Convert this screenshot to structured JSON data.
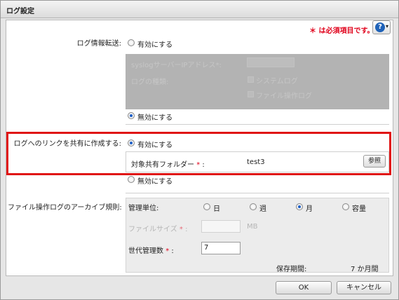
{
  "window": {
    "title": "ログ設定"
  },
  "required_note": "＊ は必須項目です。",
  "help": {
    "icon": "help-icon",
    "glyph": "?",
    "caret": "▾"
  },
  "log_transfer": {
    "label": "ログ情報転送:",
    "enable": "有効にする",
    "disable": "無効にする",
    "selected": "disable",
    "syslog_address_label": "syslogサーバーIPアドレス",
    "required_mark": "*",
    "colon": ":",
    "log_type_label": "ログの種類:",
    "system_log": "システムログ",
    "file_op_log": "ファイル操作ログ"
  },
  "shared_link": {
    "label": "ログへのリンクを共有に作成する:",
    "enable": "有効にする",
    "disable": "無効にする",
    "selected": "enable",
    "folder_label": "対象共有フォルダー",
    "required_mark": "*",
    "colon": ":",
    "folder_value": "test3",
    "browse_button": "参照"
  },
  "archive": {
    "label": "ファイル操作ログのアーカイブ規則:",
    "unit_label": "管理単位:",
    "options": [
      "日",
      "週",
      "月",
      "容量"
    ],
    "selected": "月",
    "file_size_label": "ファイルサイズ",
    "required_mark": "*",
    "colon": ":",
    "file_size_value": "",
    "file_size_unit": "MB",
    "generations_label": "世代管理数",
    "generations_value": "7",
    "retention_label": "保存期間:",
    "retention_value": "7 か月間"
  },
  "footer": {
    "ok": "OK",
    "cancel": "キャンセル"
  },
  "colors": {
    "accent": "#1f62b8",
    "required": "#e0001a",
    "highlight": "#e01414"
  }
}
